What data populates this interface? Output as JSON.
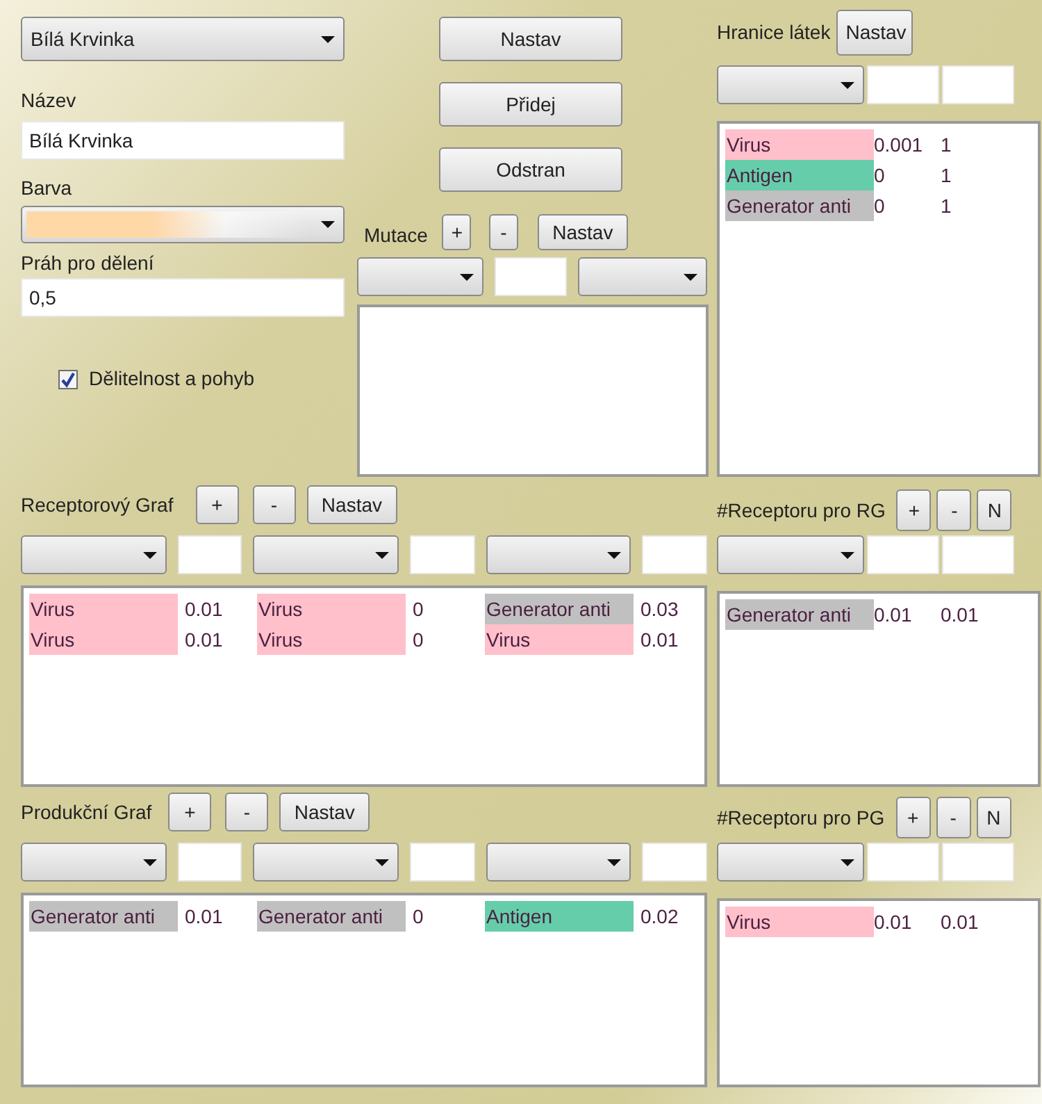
{
  "entity_select": {
    "value": "Bílá Krvinka"
  },
  "actions": [
    "Nastav",
    "Přidej",
    "Odstran"
  ],
  "name_field": {
    "label": "Název",
    "value": "Bílá Krvinka"
  },
  "color_field": {
    "label": "Barva",
    "color": "#ffd8a8"
  },
  "threshold_field": {
    "label": "Práh pro dělení",
    "value": "0,5"
  },
  "division_checkbox": {
    "label": "Dělitelnost a pohyb",
    "checked": true
  },
  "mutations": {
    "label": "Mutace",
    "buttons": [
      "+",
      "-",
      "Nastav"
    ]
  },
  "bounds": {
    "label": "Hranice látek",
    "button": "Nastav",
    "rows": [
      {
        "name": "Virus",
        "color": "#ffc0cb",
        "values": [
          "0.001",
          "1"
        ]
      },
      {
        "name": "Antigen",
        "color": "#66cdaa",
        "values": [
          "0",
          "1"
        ]
      },
      {
        "name": "Generator anti",
        "color": "#c0c0c0",
        "values": [
          "0",
          "1"
        ]
      }
    ]
  },
  "graphs": [
    {
      "label": "Receptorový Graf",
      "buttons": [
        "+",
        "-",
        "Nastav"
      ],
      "rows": [
        [
          {
            "name": "Virus",
            "color": "#ffc0cb",
            "value": "0.01"
          },
          {
            "name": "Virus",
            "color": "#ffc0cb",
            "value": "0"
          },
          {
            "name": "Generator anti",
            "color": "#c0c0c0",
            "value": "0.03"
          }
        ],
        [
          {
            "name": "Virus",
            "color": "#ffc0cb",
            "value": "0.01"
          },
          {
            "name": "Virus",
            "color": "#ffc0cb",
            "value": "0"
          },
          {
            "name": "Virus",
            "color": "#ffc0cb",
            "value": "0.01"
          }
        ]
      ],
      "side": {
        "label": "#Receptoru pro RG",
        "buttons": [
          "+",
          "-",
          "N"
        ],
        "rows": [
          {
            "name": "Generator anti",
            "color": "#c0c0c0",
            "values": [
              "0.01",
              "0.01"
            ]
          }
        ]
      }
    },
    {
      "label": "Produkční Graf",
      "buttons": [
        "+",
        "-",
        "Nastav"
      ],
      "rows": [
        [
          {
            "name": "Generator anti",
            "color": "#c0c0c0",
            "value": "0.01"
          },
          {
            "name": "Generator anti",
            "color": "#c0c0c0",
            "value": "0"
          },
          {
            "name": "Antigen",
            "color": "#66cdaa",
            "value": "0.02"
          }
        ]
      ],
      "side": {
        "label": "#Receptoru pro PG",
        "buttons": [
          "+",
          "-",
          "N"
        ],
        "rows": [
          {
            "name": "Virus",
            "color": "#ffc0cb",
            "values": [
              "0.01",
              "0.01"
            ]
          }
        ]
      }
    }
  ]
}
